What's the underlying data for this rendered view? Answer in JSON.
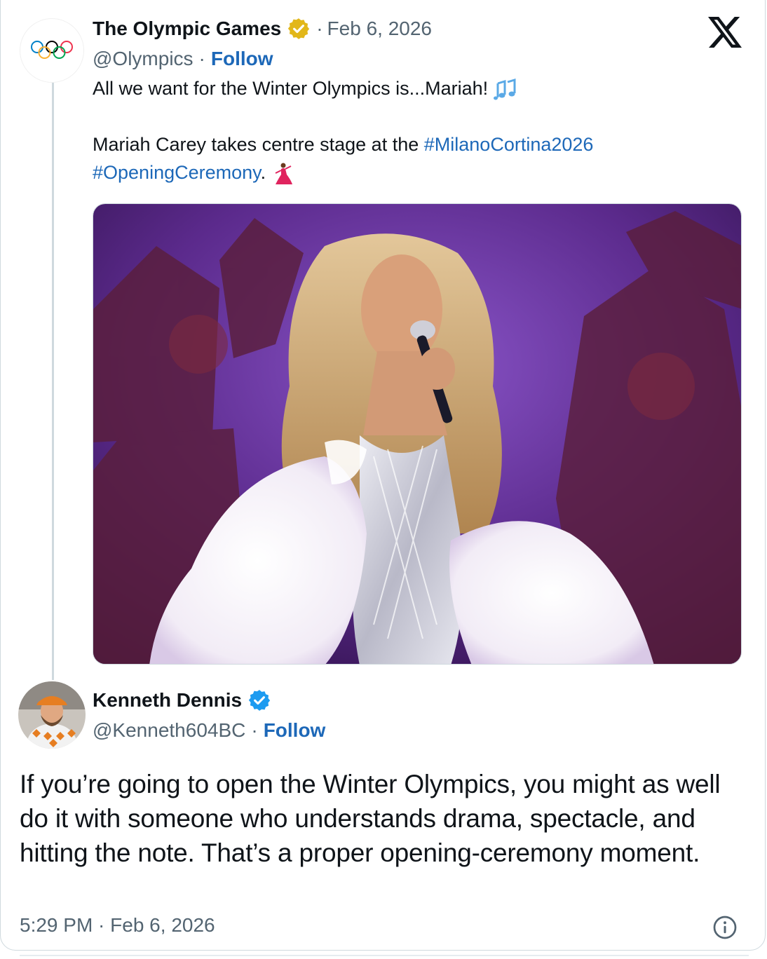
{
  "quoted_post": {
    "display_name": "The Olympic Games",
    "handle": "@Olympics",
    "separator": "·",
    "date": "Feb 6, 2026",
    "follow_label": "Follow",
    "line1": "All we want for the Winter Olympics is...Mariah!",
    "line2_prefix": "Mariah Carey takes centre stage at the",
    "hashtag1": "#MilanoCortina2026",
    "hashtag2": "#OpeningCeremony",
    "line3_suffix": ".",
    "emoji1": "music-notes-icon",
    "emoji2": "dancer-icon",
    "badge": "gold-verified-badge-icon"
  },
  "reply_post": {
    "display_name": "Kenneth Dennis",
    "handle": "@Kenneth604BC",
    "separator": "·",
    "follow_label": "Follow",
    "text": "If you’re going to open the Winter Olympics, you might as well do it with someone who understands drama, spectacle, and hitting the note. That’s a proper opening-ceremony moment.",
    "timestamp": "5:29 PM · Feb 6, 2026",
    "badge": "blue-verified-badge-icon"
  },
  "brand": {
    "logo": "x-logo-icon"
  },
  "colors": {
    "link": "#1d68b8",
    "muted": "#536471",
    "gold_badge": "#e2b719",
    "blue_badge": "#1d9bf0",
    "stage_purple": "#5b2a8c"
  }
}
